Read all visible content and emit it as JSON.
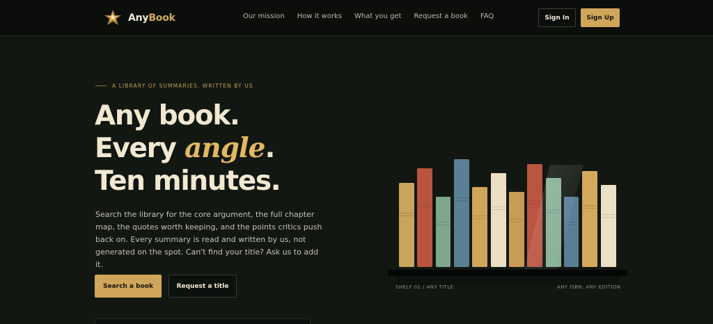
{
  "nav": {
    "logo_icon": "laurel-star-icon",
    "logo_text_1": "Any",
    "logo_text_2": "Book",
    "links": [
      "Our mission",
      "How it works",
      "What you get",
      "Request a book",
      "FAQ"
    ],
    "signin_label": "Sign In",
    "signup_label": "Sign Up"
  },
  "hero": {
    "eyebrow": "A LIBRARY OF SUMMARIES, WRITTEN BY US",
    "headline_1": "Any book.",
    "headline_2_pre": "Every ",
    "headline_2_accent": "angle",
    "headline_2_post": ".",
    "headline_3": "Ten minutes.",
    "description": "Search the library for the core argument, the full chapter map, the quotes worth keeping, and the points critics push back on. Every summary is read and written by us, not generated on the spot. Can't find your title? Ask us to add it.",
    "primary_cta": "Search a book",
    "secondary_cta": "Request a title"
  },
  "shelf": {
    "caption_left": "SHELF 01 / ANY TITLE",
    "caption_right": "ANY ISBN. ANY EDITION",
    "books": [
      {
        "color": "#caa35c"
      },
      {
        "color": "#b9543e"
      },
      {
        "color": "#7ea68c"
      },
      {
        "color": "#5b7f95"
      },
      {
        "color": "#d0a65a"
      },
      {
        "color": "#eadfc3"
      },
      {
        "color": "#c99c55"
      },
      {
        "color": "#bb5440"
      },
      {
        "color": "#86b095"
      },
      {
        "color": "#5b7d95"
      },
      {
        "color": "#d4a95c"
      },
      {
        "color": "#ebe1c6"
      }
    ]
  },
  "colors": {
    "background": "#121712",
    "accent": "#d0a65a"
  }
}
